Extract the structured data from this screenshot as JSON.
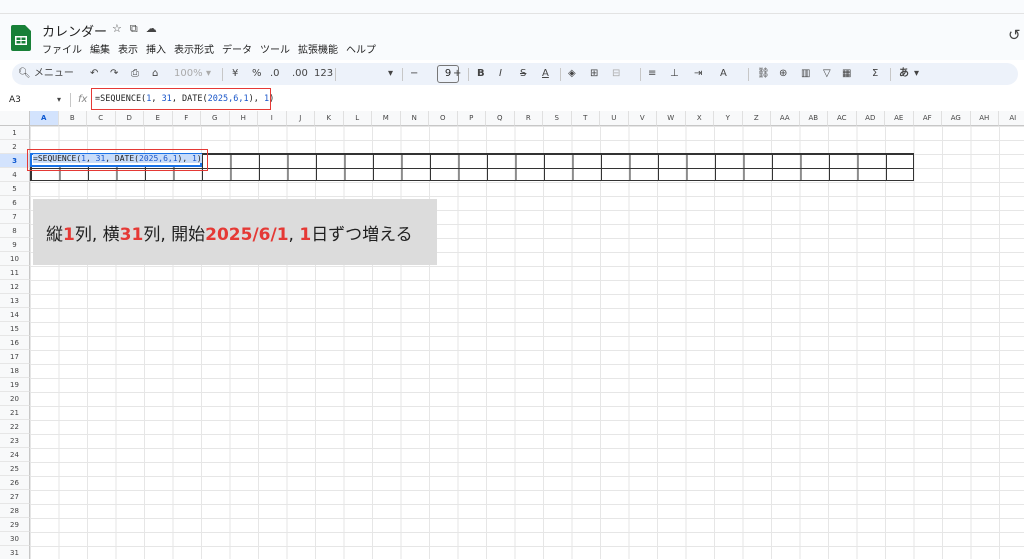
{
  "doc": {
    "title": "カレンダー"
  },
  "menu": [
    "ファイル",
    "編集",
    "表示",
    "挿入",
    "表示形式",
    "データ",
    "ツール",
    "拡張機能",
    "ヘルプ"
  ],
  "toolbar": {
    "search_label": "メニュー",
    "zoom": "100%",
    "currency": "¥",
    "percent": "%",
    "dec_decrease": ".0",
    "dec_increase": ".00",
    "format_123": "123",
    "font_size": "9",
    "bold": "B",
    "italic": "I",
    "strike": "S",
    "text_color": "A",
    "sum": "Σ",
    "input_mode": "あ"
  },
  "formula_bar": {
    "name_box": "A3",
    "fx": "fx",
    "f_prefix": "=SEQUENCE(",
    "f_n1": "1",
    "f_c1": ", ",
    "f_n2": "31",
    "f_c2": ", DATE(",
    "f_n3": "2025,6,1",
    "f_c3": "), ",
    "f_n4": "1",
    "f_suffix": ")"
  },
  "columns": [
    "A",
    "B",
    "C",
    "D",
    "E",
    "F",
    "G",
    "H",
    "I",
    "J",
    "K",
    "L",
    "M",
    "N",
    "O",
    "P",
    "Q",
    "R",
    "S",
    "T",
    "U",
    "V",
    "W",
    "X",
    "Y",
    "Z",
    "AA",
    "AB",
    "AC",
    "AD",
    "AE",
    "AF",
    "AG",
    "AH",
    "AI"
  ],
  "rows": [
    "1",
    "2",
    "3",
    "4",
    "5",
    "6",
    "7",
    "8",
    "9",
    "10",
    "11",
    "12",
    "13",
    "14",
    "15",
    "16",
    "17",
    "18",
    "19",
    "20",
    "21",
    "22",
    "23",
    "24",
    "25",
    "26",
    "27",
    "28",
    "29",
    "30",
    "31"
  ],
  "selected": {
    "column": "A",
    "row": "3"
  },
  "note": {
    "p1": "縦",
    "n1": "1",
    "p2": "列, 横",
    "n2": "31",
    "p3": "列, 開始",
    "n3": "2025/6/1",
    "p4": ", ",
    "n4": "1",
    "p5": "日ずつ増える"
  },
  "colors": {
    "accent": "#1a73e8",
    "highlight_red": "#e53935",
    "sheets_green": "#188038"
  }
}
